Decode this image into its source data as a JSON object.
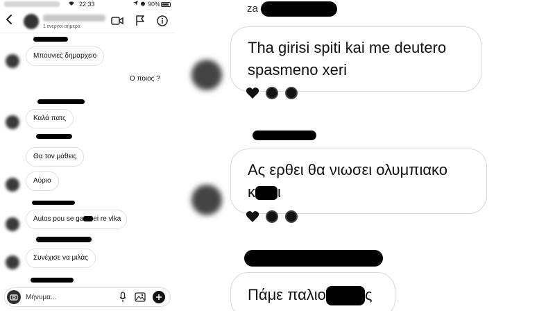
{
  "status_bar": {
    "time": "22:33",
    "battery": "90%"
  },
  "header": {
    "active_status": "1 ενεργοί σήμερα"
  },
  "messages_left": [
    {
      "side": "received",
      "text": "Μπουνιες δημαρχειο"
    },
    {
      "side": "sent",
      "text": "Ο ποιος ?"
    },
    {
      "side": "received",
      "text": "Καλά πατς"
    },
    {
      "side": "received",
      "text": "Θα τον μάθεις"
    },
    {
      "side": "received",
      "text": "Αύριο"
    },
    {
      "side": "received",
      "text": "Autos pou se ga"
    },
    {
      "side": "received",
      "text": "ei re vlka"
    },
    {
      "side": "received",
      "text": "Συνέχισε να μιλάς"
    }
  ],
  "composer": {
    "placeholder": "Μήνυμα..."
  },
  "zoom": {
    "sender_top_prefix": "za",
    "messages": [
      {
        "text": "Tha girisi spiti kai me deutero spasmeno xeri"
      },
      {
        "text_a": "Ας ερθει θα νιωσει ολυμπιακο",
        "text_b": "κ",
        "text_c": "ι"
      },
      {
        "text_a": "Πάμε παλιο",
        "text_b": "ς"
      }
    ]
  },
  "icons": {
    "back": "chevron-left-icon",
    "video": "video-camera-icon",
    "flag": "flag-icon",
    "info": "info-icon",
    "camera": "camera-icon",
    "mic": "microphone-icon",
    "gallery": "image-gallery-icon",
    "add": "plus-icon",
    "reaction": "heart-icon"
  },
  "colors": {
    "redaction": "#000000",
    "bubble_border": "#e0e0e0"
  }
}
